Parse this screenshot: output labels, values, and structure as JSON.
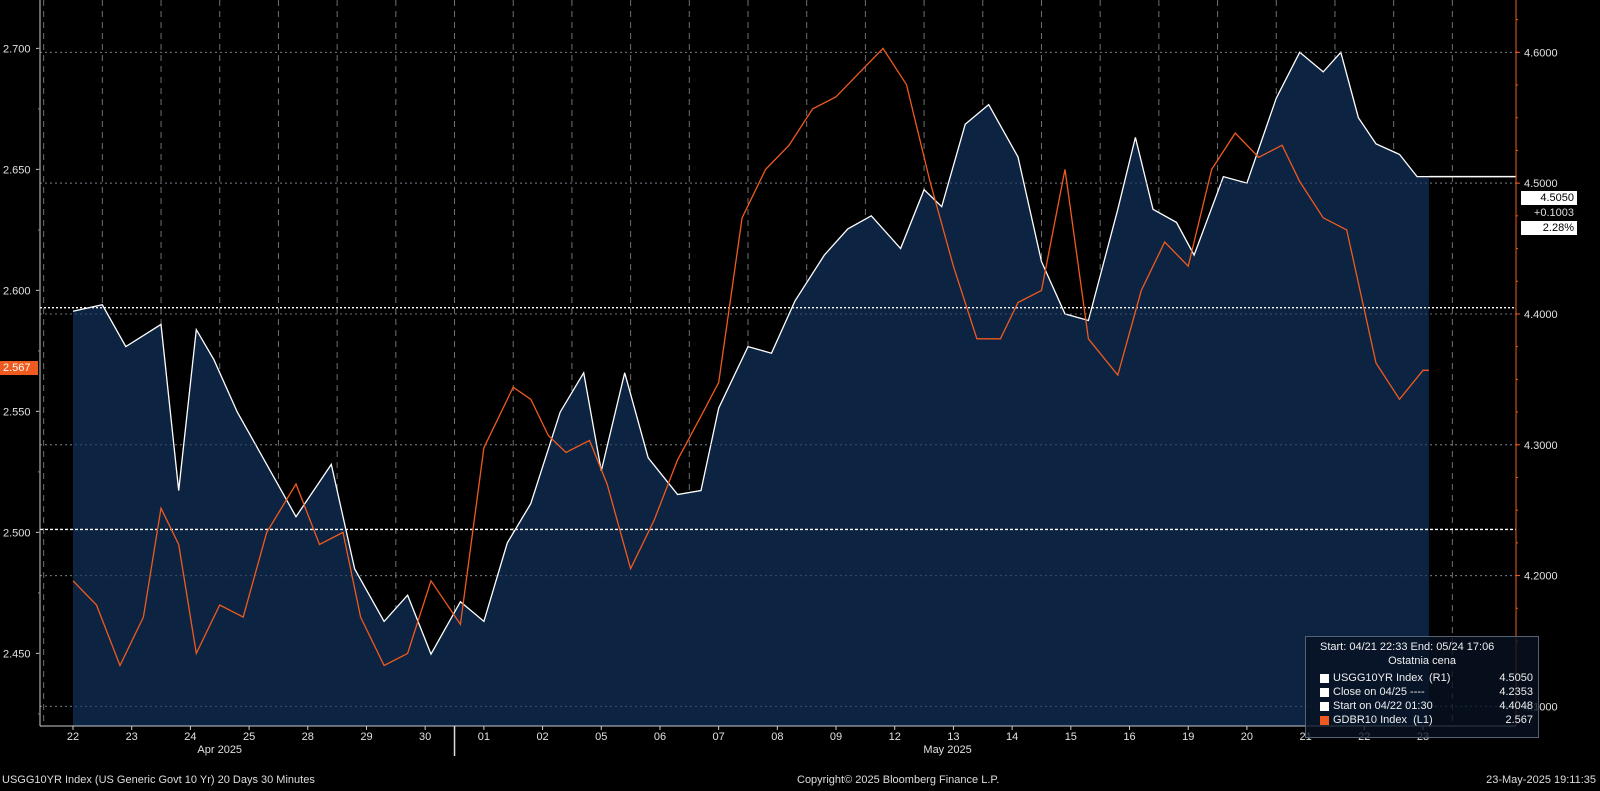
{
  "chart_data": {
    "type": "line",
    "x_ticks": [
      "22",
      "23",
      "24",
      "25",
      "28",
      "29",
      "30",
      "01",
      "02",
      "05",
      "06",
      "07",
      "08",
      "09",
      "12",
      "13",
      "14",
      "15",
      "16",
      "19",
      "20",
      "21",
      "22",
      "23"
    ],
    "month_labels": [
      "Apr 2025",
      "May 2025"
    ],
    "left_axis": {
      "label": "",
      "range": [
        2.42,
        2.72
      ],
      "ticks": [
        "2.450",
        "2.500",
        "2.550",
        "2.600",
        "2.650",
        "2.700"
      ]
    },
    "right_axis": {
      "label": "",
      "range": [
        4.085,
        4.64
      ],
      "ticks": [
        "4.1000",
        "4.2000",
        "4.3000",
        "4.4000",
        "4.5000",
        "4.6000"
      ]
    },
    "series": [
      {
        "name": "USGG10YR Index (R1)",
        "axis": "right",
        "color": "#ffffff",
        "style": "area",
        "x": [
          0,
          0.5,
          0.9,
          1.5,
          1.8,
          2.1,
          2.4,
          2.8,
          3.3,
          3.8,
          4.4,
          4.8,
          5.3,
          5.7,
          6.1,
          6.6,
          7.0,
          7.4,
          7.8,
          8.3,
          8.7,
          9.0,
          9.4,
          9.8,
          10.3,
          10.7,
          11.0,
          11.5,
          11.9,
          12.3,
          12.8,
          13.2,
          13.6,
          14.1,
          14.5,
          14.8,
          15.2,
          15.6,
          16.1,
          16.5,
          16.9,
          17.3,
          17.8,
          18.1,
          18.4,
          18.8,
          19.1,
          19.6,
          20.0,
          20.5,
          20.9,
          21.3,
          21.6,
          21.9,
          22.2,
          22.6,
          22.9,
          23.1
        ],
        "y": [
          4.402,
          4.407,
          4.375,
          4.392,
          4.265,
          4.388,
          4.365,
          4.325,
          4.285,
          4.245,
          4.285,
          4.205,
          4.165,
          4.185,
          4.14,
          4.18,
          4.165,
          4.225,
          4.255,
          4.325,
          4.355,
          4.28,
          4.355,
          4.29,
          4.262,
          4.265,
          4.328,
          4.375,
          4.37,
          4.41,
          4.445,
          4.465,
          4.475,
          4.45,
          4.495,
          4.482,
          4.545,
          4.56,
          4.52,
          4.44,
          4.4,
          4.395,
          4.48,
          4.535,
          4.48,
          4.47,
          4.445,
          4.505,
          4.5,
          4.565,
          4.6,
          4.585,
          4.6,
          4.55,
          4.53,
          4.522,
          4.505,
          4.505
        ]
      },
      {
        "name": "GDBR10 Index (L1)",
        "axis": "left",
        "color": "#ef5a1e",
        "style": "line",
        "x": [
          0,
          0.4,
          0.8,
          1.2,
          1.5,
          1.8,
          2.1,
          2.5,
          2.9,
          3.3,
          3.8,
          4.2,
          4.6,
          4.9,
          5.3,
          5.7,
          6.1,
          6.6,
          7.0,
          7.5,
          7.8,
          8.1,
          8.4,
          8.8,
          9.1,
          9.5,
          9.9,
          10.3,
          10.7,
          11.0,
          11.4,
          11.8,
          12.2,
          12.6,
          13.0,
          13.4,
          13.8,
          14.2,
          14.6,
          15.0,
          15.4,
          15.8,
          16.1,
          16.5,
          16.9,
          17.3,
          17.8,
          18.2,
          18.6,
          19.0,
          19.4,
          19.8,
          20.2,
          20.6,
          20.9,
          21.3,
          21.7,
          22.2,
          22.6,
          23.0,
          23.1
        ],
        "y": [
          2.48,
          2.47,
          2.445,
          2.465,
          2.51,
          2.495,
          2.45,
          2.47,
          2.465,
          2.5,
          2.52,
          2.495,
          2.5,
          2.465,
          2.445,
          2.45,
          2.48,
          2.462,
          2.535,
          2.56,
          2.555,
          2.54,
          2.533,
          2.538,
          2.52,
          2.485,
          2.505,
          2.53,
          2.548,
          2.562,
          2.63,
          2.65,
          2.66,
          2.675,
          2.68,
          2.69,
          2.7,
          2.685,
          2.645,
          2.61,
          2.58,
          2.58,
          2.595,
          2.6,
          2.65,
          2.58,
          2.565,
          2.6,
          2.62,
          2.61,
          2.65,
          2.665,
          2.655,
          2.66,
          2.645,
          2.63,
          2.625,
          2.57,
          2.555,
          2.567,
          2.567
        ]
      }
    ],
    "hlines": [
      {
        "name": "Close on 04/25",
        "axis": "right",
        "value": 4.2353,
        "style": "dashed"
      },
      {
        "name": "Start on 04/22 01:30",
        "axis": "right",
        "value": 4.4048,
        "style": "dotted"
      }
    ],
    "last_markers": {
      "right": {
        "value": "4.5050",
        "change": "+0.1003",
        "pct": "2.28%"
      },
      "left": {
        "value": "2.567",
        "color": "#ef5a1e"
      }
    },
    "grid": true
  },
  "legend": {
    "header": "Start: 04/21 22:33 End: 05/24 17:06",
    "sub": "Ostatnia cena",
    "rows": [
      {
        "label": "USGG10YR Index  (R1)",
        "value": "4.5050",
        "color": "#ffffff"
      },
      {
        "label": "Close on 04/25 ----",
        "value": "4.2353",
        "color": "#ffffff"
      },
      {
        "label": "Start on 04/22 01:30",
        "value": "4.4048",
        "color": "#ffffff"
      },
      {
        "label": "GDBR10 Index  (L1)",
        "value": "2.567",
        "color": "#ef5a1e"
      }
    ]
  },
  "footer": {
    "left": "USGG10YR Index (US Generic Govt 10 Yr) 20 Days 30 Minutes",
    "center": "Copyright© 2025 Bloomberg Finance L.P.",
    "right": "23-May-2025 19:11:35"
  }
}
